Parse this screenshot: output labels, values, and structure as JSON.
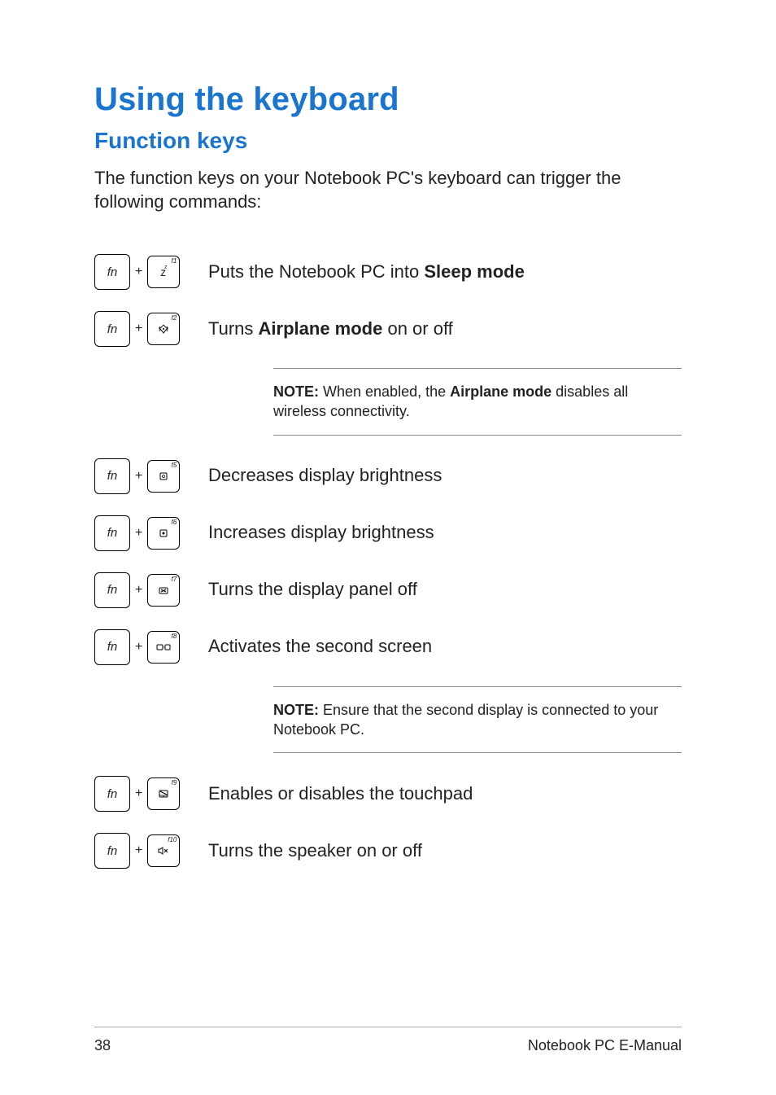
{
  "title": "Using the keyboard",
  "subtitle": "Function keys",
  "intro": "The function keys on your Notebook PC's keyboard can trigger the following commands:",
  "combos": {
    "fn_label": "fn",
    "plus": "+",
    "f1": {
      "fnum": "f1",
      "desc_pre": "Puts the Notebook PC into ",
      "desc_bold": "Sleep mode",
      "desc_post": ""
    },
    "f2": {
      "fnum": "f2",
      "desc_pre": "Turns ",
      "desc_bold": "Airplane mode",
      "desc_post": " on or off"
    },
    "f5": {
      "fnum": "f5",
      "desc": "Decreases display brightness"
    },
    "f6": {
      "fnum": "f6",
      "desc": "Increases display brightness"
    },
    "f7": {
      "fnum": "f7",
      "desc": "Turns the display panel off"
    },
    "f8": {
      "fnum": "f8",
      "desc": "Activates the second screen"
    },
    "f9": {
      "fnum": "f9",
      "desc": "Enables or disables the touchpad"
    },
    "f10": {
      "fnum": "f10",
      "desc": "Turns the speaker on or off"
    }
  },
  "notes": {
    "airplane": {
      "label": "NOTE:",
      "pre": " When enabled, the ",
      "bold": "Airplane mode",
      "post": " disables all wireless connectivity."
    },
    "secondscreen": {
      "label": "NOTE:",
      "text": " Ensure that the second display is connected to your Notebook PC."
    }
  },
  "footer": {
    "page": "38",
    "doc": "Notebook PC E-Manual"
  }
}
